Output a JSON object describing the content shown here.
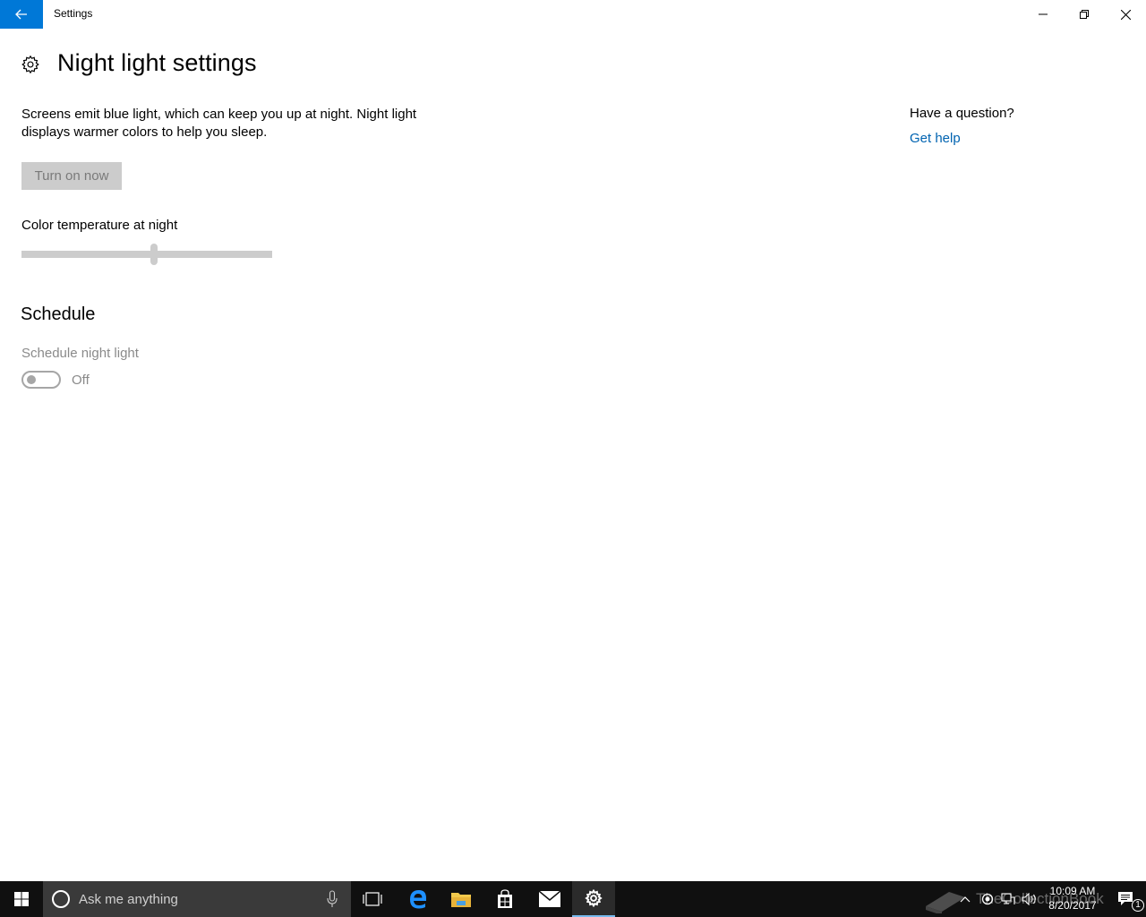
{
  "window": {
    "title": "Settings",
    "accent_color": "#0078d7"
  },
  "page": {
    "title": "Night light settings",
    "description": "Screens emit blue light, which can keep you up at night. Night light displays warmer colors to help you sleep.",
    "turn_on_button": "Turn on now",
    "color_temperature": {
      "label": "Color temperature at night",
      "value_fraction": 0.53
    },
    "schedule": {
      "heading": "Schedule",
      "label": "Schedule night light",
      "toggle_state": "Off"
    }
  },
  "help": {
    "question": "Have a question?",
    "link": "Get help",
    "link_color": "#0063b1"
  },
  "taskbar": {
    "search_placeholder": "Ask me anything",
    "pinned_icons": [
      "task-view-icon",
      "edge-icon",
      "file-explorer-icon",
      "store-icon",
      "mail-icon",
      "settings-icon"
    ],
    "active_app": "settings-icon",
    "watermark": "TheCollectionBook",
    "time": "10:09 AM",
    "date": "8/20/2017",
    "notification_count": "1"
  }
}
